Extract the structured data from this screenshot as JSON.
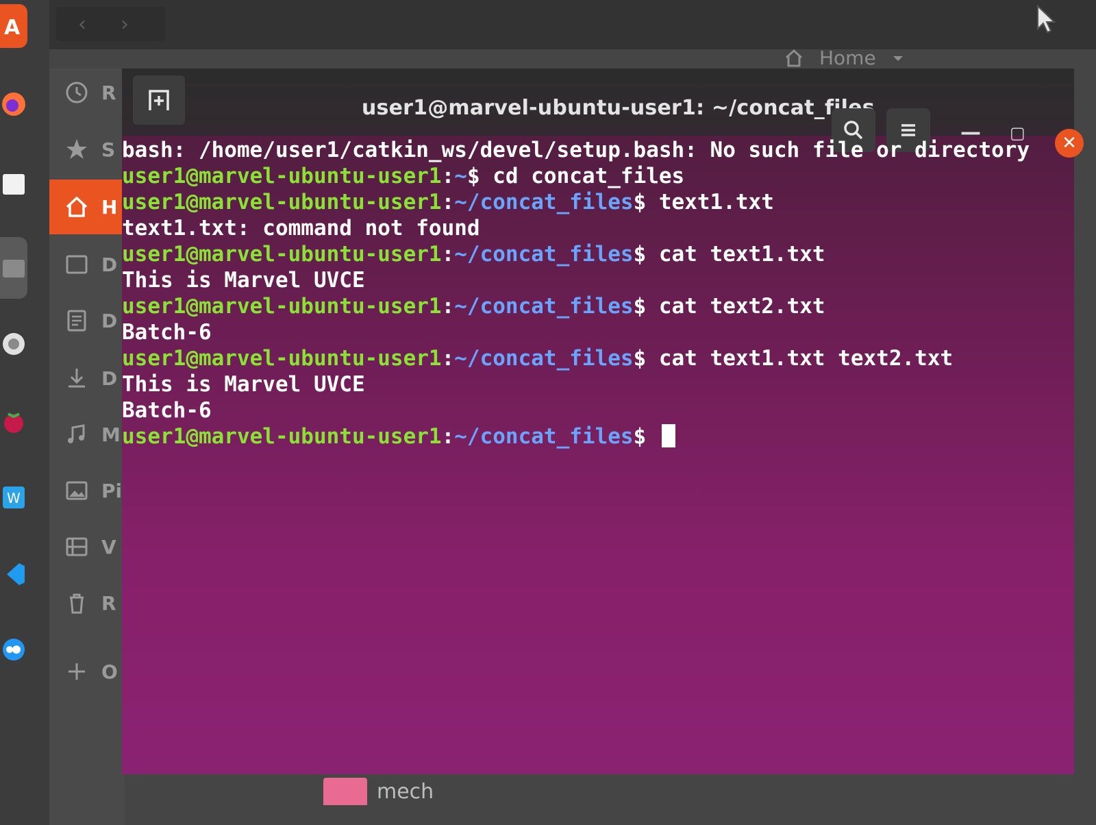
{
  "files": {
    "path_label": "Home",
    "sidebar": [
      {
        "key": "recent",
        "label": "R",
        "icon": "clock-icon"
      },
      {
        "key": "starred",
        "label": "S",
        "icon": "star-icon"
      },
      {
        "key": "home",
        "label": "H",
        "icon": "home-icon",
        "active": true
      },
      {
        "key": "desktop",
        "label": "D",
        "icon": "desktop-icon"
      },
      {
        "key": "documents",
        "label": "D",
        "icon": "documents-icon"
      },
      {
        "key": "downloads",
        "label": "D",
        "icon": "download-icon"
      },
      {
        "key": "music",
        "label": "M",
        "icon": "music-icon"
      },
      {
        "key": "pictures",
        "label": "Pi",
        "icon": "pictures-icon"
      },
      {
        "key": "videos",
        "label": "V",
        "icon": "video-icon"
      },
      {
        "key": "trash",
        "label": "R",
        "icon": "trash-icon"
      },
      {
        "key": "other",
        "label": "O",
        "icon": "plus-icon"
      }
    ],
    "folder_name": "mech"
  },
  "terminal": {
    "title": "user1@marvel-ubuntu-user1: ~/concat_files",
    "accent": "#e95420",
    "lines": [
      {
        "type": "out",
        "text": "bash: /home/user1/catkin_ws/devel/setup.bash: No such file or directory"
      },
      {
        "type": "prompt",
        "user": "user1@marvel-ubuntu-user1",
        "path": "~",
        "cmd": "cd concat_files"
      },
      {
        "type": "prompt",
        "user": "user1@marvel-ubuntu-user1",
        "path": "~/concat_files",
        "cmd": "text1.txt"
      },
      {
        "type": "out",
        "text": "text1.txt: command not found"
      },
      {
        "type": "prompt",
        "user": "user1@marvel-ubuntu-user1",
        "path": "~/concat_files",
        "cmd": "cat text1.txt"
      },
      {
        "type": "out",
        "text": "This is Marvel UVCE"
      },
      {
        "type": "prompt",
        "user": "user1@marvel-ubuntu-user1",
        "path": "~/concat_files",
        "cmd": "cat text2.txt"
      },
      {
        "type": "out",
        "text": "Batch-6"
      },
      {
        "type": "prompt",
        "user": "user1@marvel-ubuntu-user1",
        "path": "~/concat_files",
        "cmd": "cat text1.txt text2.txt"
      },
      {
        "type": "out",
        "text": "This is Marvel UVCE"
      },
      {
        "type": "out",
        "text": "Batch-6"
      },
      {
        "type": "prompt",
        "user": "user1@marvel-ubuntu-user1",
        "path": "~/concat_files",
        "cmd": ""
      }
    ]
  },
  "dock": [
    {
      "icon": "software-icon",
      "color": "#e95420"
    },
    {
      "icon": "firefox-icon",
      "color": "#ff7139"
    },
    {
      "icon": "files-icon",
      "color": "#f2f2f2"
    },
    {
      "icon": "window-icon",
      "color": "#8a8a8a"
    },
    {
      "icon": "settings-icon",
      "color": "#e0e0e0"
    },
    {
      "icon": "raspberry-icon",
      "color": "#c51a4a"
    },
    {
      "icon": "editor-icon",
      "color": "#2aa3e8"
    },
    {
      "icon": "vscode-icon",
      "color": "#1f9cf0"
    },
    {
      "icon": "cloud-icon",
      "color": "#2196f3"
    }
  ]
}
